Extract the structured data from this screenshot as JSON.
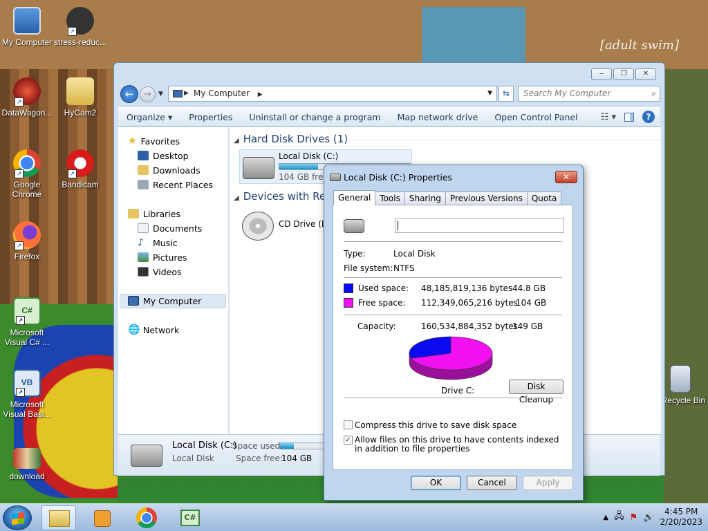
{
  "desktop": {
    "watermark": "[adult swim]",
    "icons": [
      {
        "label": "My Computer"
      },
      {
        "label": "stress-reduc..."
      },
      {
        "label": "DataWagon..."
      },
      {
        "label": "HyCam2"
      },
      {
        "label": "Google Chrome"
      },
      {
        "label": "Bandicam"
      },
      {
        "label": "Firefox"
      },
      {
        "label": "Microsoft Visual C# ..."
      },
      {
        "label": "Microsoft Visual Basi..."
      },
      {
        "label": "download"
      },
      {
        "label": "Recycle Bin"
      }
    ]
  },
  "explorer": {
    "caption_buttons": [
      "‒",
      "❐",
      "✕"
    ],
    "address_text": "My Computer",
    "search_placeholder": "Search My Computer",
    "toolbar": [
      "Organize ▾",
      "Properties",
      "Uninstall or change a program",
      "Map network drive",
      "Open Control Panel"
    ],
    "nav": {
      "favorites": "Favorites",
      "favorite_items": [
        "Desktop",
        "Downloads",
        "Recent Places"
      ],
      "libraries": "Libraries",
      "library_items": [
        "Documents",
        "Music",
        "Pictures",
        "Videos"
      ],
      "computer": "My Computer",
      "network": "Network"
    },
    "content": {
      "hdd_header": "Hard Disk Drives (1)",
      "removable_header": "Devices with Rem",
      "drive_name": "Local Disk (C:)",
      "drive_free": "104 GB free o",
      "drive_used_fraction": 0.3,
      "cd_name": "CD Drive (D:"
    },
    "details": {
      "name": "Local Disk (C:)",
      "type": "Local Disk",
      "space_used_label": "Space used:",
      "space_free_label": "Space free:",
      "space_free": "104 GB"
    }
  },
  "dialog": {
    "title": "Local Disk (C:) Properties",
    "close": "✕",
    "tabs": [
      "General",
      "Tools",
      "Sharing",
      "Previous Versions",
      "Quota"
    ],
    "type_label": "Type:",
    "type_value": "Local Disk",
    "fs_label": "File system:",
    "fs_value": "NTFS",
    "used_label": "Used space:",
    "used_bytes": "48,185,819,136 bytes",
    "used_gb": "44.8 GB",
    "free_label": "Free space:",
    "free_bytes": "112,349,065,216 bytes",
    "free_gb": "104 GB",
    "cap_label": "Capacity:",
    "cap_bytes": "160,534,884,352 bytes",
    "cap_gb": "149 GB",
    "drive_label": "Drive C:",
    "cleanup": "Disk Cleanup",
    "compress": "Compress this drive to save disk space",
    "index": "Allow files on this drive to have contents indexed in addition to file properties",
    "compress_checked": false,
    "index_checked": true,
    "ok": "OK",
    "cancel": "Cancel",
    "apply": "Apply",
    "used_color": "#0a0af0",
    "free_color": "#f010f0",
    "used_fraction": 0.3
  },
  "taskbar": {
    "time": "4:45 PM",
    "date": "2/20/2023"
  }
}
